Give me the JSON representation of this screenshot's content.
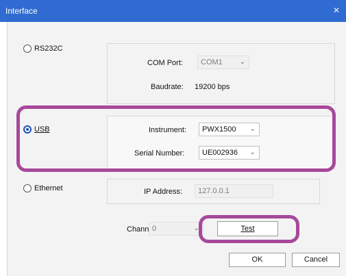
{
  "window": {
    "title": "Interface",
    "close_glyph": "×"
  },
  "rs232c": {
    "label": "RS232C",
    "com_port_label": "COM Port:",
    "com_port_value": "COM1",
    "baudrate_label": "Baudrate:",
    "baudrate_value": "19200 bps"
  },
  "usb": {
    "label": "USB",
    "instrument_label": "Instrument:",
    "instrument_value": "PWX1500",
    "serial_label": "Serial Number:",
    "serial_value": "UE002936"
  },
  "ethernet": {
    "label": "Ethernet",
    "ip_label": "IP Address:",
    "ip_value": "127.0.0.1"
  },
  "channel": {
    "label": "Channel:",
    "value": "0"
  },
  "buttons": {
    "test": "Test",
    "ok": "OK",
    "cancel": "Cancel"
  },
  "colors": {
    "highlight": "#a7489a",
    "titlebar": "#2f6bd0"
  }
}
